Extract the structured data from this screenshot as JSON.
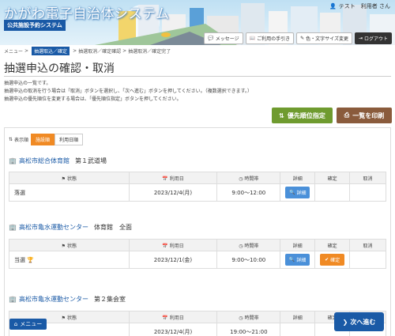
{
  "header": {
    "title": "かがわ電子自治体システム",
    "subtitle": "公共施設予約システム",
    "user": "テスト　利用者 さん",
    "buttons": [
      "メッセージ",
      "ご利用の手引き",
      "色・文字サイズ変更",
      "ログアウト"
    ]
  },
  "breadcrumb": [
    "メニュー",
    "抽選取込／確定",
    "抽選取消／確定確認",
    "抽選取消／確定完了"
  ],
  "page_title": "抽選申込の確認・取消",
  "description": [
    "抽選申込の一覧です。",
    "抽選申込の取消を行う場合は「取消」ボタンを選択し、「次へ進む」ボタンを押してください。（複数選択できます。）",
    "抽選申込の優先順位を変更する場合は、「優先順位指定」ボタンを押してください。"
  ],
  "actions": {
    "priority": "優先順位指定",
    "print": "一覧を印刷"
  },
  "sort": {
    "label": "表示順",
    "options": [
      "施設順",
      "利用日順"
    ],
    "selected": "施設順"
  },
  "columns": {
    "status": "状態",
    "date": "利用日",
    "time": "時間帯",
    "detail": "詳細",
    "confirm": "確定",
    "cancel": "取消"
  },
  "buttons": {
    "detail": "詳細",
    "confirm": "確定"
  },
  "facilities": [
    {
      "name": "高松市総合体育館",
      "detail": "第１武道場",
      "status": "落選",
      "date": "2023/12/4(月)",
      "time": "9:00～12:00",
      "confirm": false
    },
    {
      "name": "高松市亀水運動センター",
      "detail": "体育館　全面",
      "status": "当選",
      "date": "2023/12/1(金)",
      "time": "9:00～10:00",
      "confirm": true
    },
    {
      "name": "高松市亀水運動センター",
      "detail": "第２集会室",
      "status": "",
      "date": "2023/12/4(月)",
      "time": "19:00～21:00",
      "confirm": false
    }
  ],
  "footer": {
    "menu": "メニュー",
    "next": "次へ進む"
  }
}
